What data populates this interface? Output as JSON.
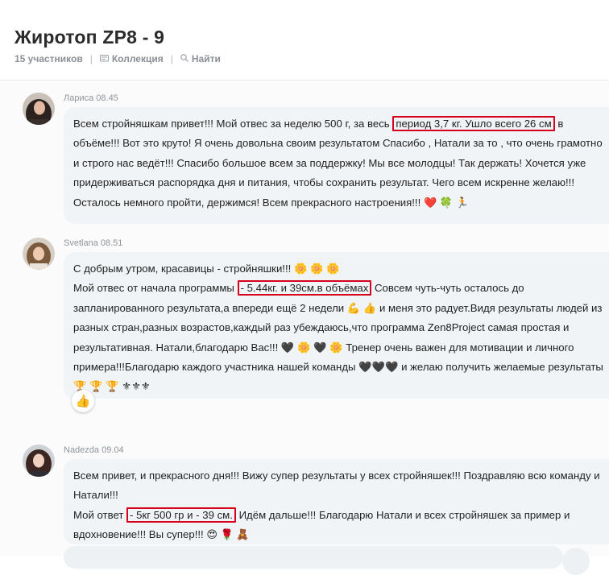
{
  "header": {
    "title": "Жиротоп ZP8 - 9",
    "participants": "15 участников",
    "collection": "Коллекция",
    "find": "Найти",
    "separator": "|",
    "collection_icon": "collection-icon",
    "search_icon": "search-icon"
  },
  "messages": [
    {
      "author": "Лариса 08.45",
      "avatar": "avatar-larisa",
      "text_1": "Всем стройняшкам привет!!! Мой отвес за неделю 500 г, за весь ",
      "highlight": "период 3,7 кг. Ушло всего 26 см",
      "text_2": " в объёме!!! Вот это круто! Я  очень довольна своим результатом Спасибо , Натали за то , что очень грамотно и строго нас ведёт!!! Спасибо большое всем за поддержку! Мы все молодцы! Так держать! Хочется уже придерживаться распорядка дня и питания, чтобы сохранить результат. Чего всем искренне желаю!!! Осталось немного пройти, держимся! Всем прекрасного настроения!!!",
      "emoji": "❤️ 🍀 🏃"
    },
    {
      "author": "Svetlana 08.51",
      "avatar": "avatar-svetlana",
      "line_1": "С добрым утром, красавицы - стройняшки!!! 🌼 🌼 🌼",
      "text_1": "Мой отвес от начала программы ",
      "highlight": "- 5.44кг. и 39см.в объёмах",
      "text_2": " Совсем   чуть-чуть осталось до запланированного результата,а впереди ещё 2 недели 💪 👍 и меня это радует.Видя  результаты людей из разных стран,разных возрастов,каждый раз убеждаюсь,что программа  Zen8Project самая простая и результативная. Натали,благодарю Вас!!! 🖤 🌼 🖤 🌼 Тренер очень важен для мотивации и личного примера!!!Благодарю каждого участника нашей команды 🖤🖤🖤 и желаю получить желаемые результаты 🏆 🏆 🏆 ⚜⚜⚜",
      "reaction": "👍"
    },
    {
      "author": "Nadezda 09.04",
      "avatar": "avatar-nadezda",
      "line_1": "Всем привет, и прекрасного дня!!! Вижу супер результаты у всех стройняшек!!! Поздравляю всю команду и Натали!!!",
      "text_1": "Мой ответ ",
      "highlight": "- 5кг 500 гр и - 39 см.",
      "text_2": " Идём дальше!!! Благодарю Натали и всех стройняшек за пример и вдохновение!!! Вы супер!!!",
      "emoji": "😍 🌹 🧸"
    }
  ],
  "colors": {
    "highlight_border": "#d6001c",
    "bubble_bg": "#f1f4f6",
    "author_text": "#8e949b"
  }
}
